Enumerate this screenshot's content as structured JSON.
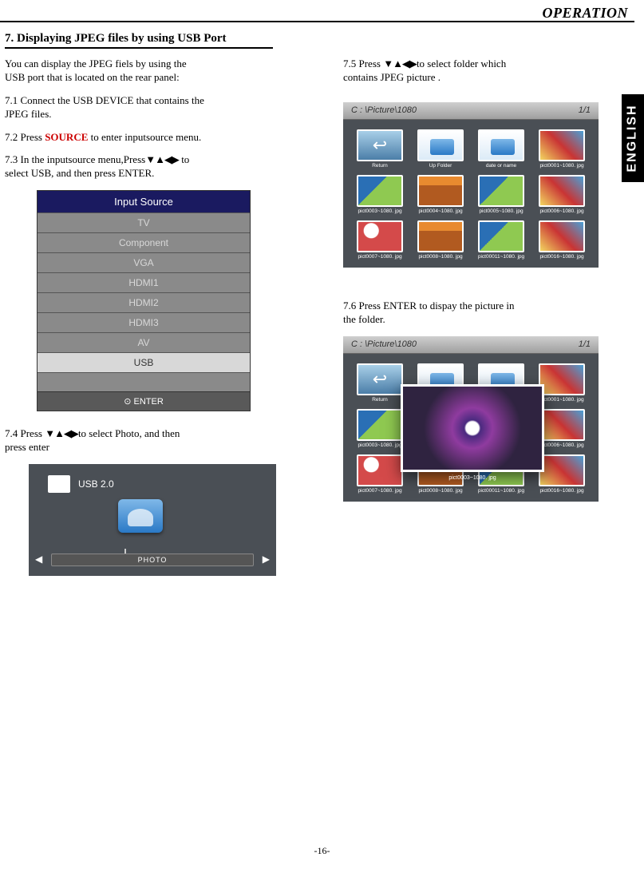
{
  "header": {
    "section": "OPERATION",
    "lang_tab": "ENGLISH",
    "page_number": "-16-"
  },
  "title": "7.  Displaying JPEG files by using USB Port",
  "left": {
    "intro1": "You can display the JPEG fiels by using the",
    "intro2": "USB port that is located on the rear panel:",
    "p71a": "7.1  Connect the USB DEVICE that contains the",
    "p71b": "JPEG files.",
    "p72a": "7.2  Press ",
    "p72b": "SOURCE",
    "p72c": " to enter inputsource menu.",
    "p73a": "7.3  In the inputsource menu,Press",
    "p73b": " to",
    "p73c": "select USB, and then press ENTER.",
    "arrows": "▼▲◀▶",
    "p74a": "7.4 Press ",
    "p74b": "to select Photo, and then",
    "p74c": "press enter"
  },
  "right": {
    "p75a": "7.5  Press ",
    "p75b": "to select folder which",
    "p75c": "contains  JPEG picture .",
    "p76a": "7.6  Press ENTER to dispay the picture in",
    "p76b": "the folder.",
    "arrows": "▼▲◀▶"
  },
  "input_source": {
    "title": "Input Source",
    "items": [
      "TV",
      "Component",
      "VGA",
      "HDMI1",
      "HDMI2",
      "HDMI3",
      "AV",
      "USB"
    ],
    "footer": "⊙ ENTER"
  },
  "usb": {
    "title": "USB 2.0",
    "bar_label": "PHOTO",
    "left_arrow": "◀",
    "right_arrow": "▶"
  },
  "browser": {
    "path": "C : \\Picture\\1080",
    "page": "1/1",
    "row1": [
      "Return",
      "Up Folder",
      "date  or  name",
      "pict0001~1080. jpg"
    ],
    "row2": [
      "pict0003~1080. jpg",
      "pict0004~1080. jpg",
      "pict0005~1080. jpg",
      "pict0006~1080. jpg"
    ],
    "row3": [
      "pict0007~1080. jpg",
      "pict0008~1080. jpg",
      "pict00011~1080. jpg",
      "pict0016~1080. jpg"
    ],
    "preview_label": "pict0003~1080. jpg"
  }
}
